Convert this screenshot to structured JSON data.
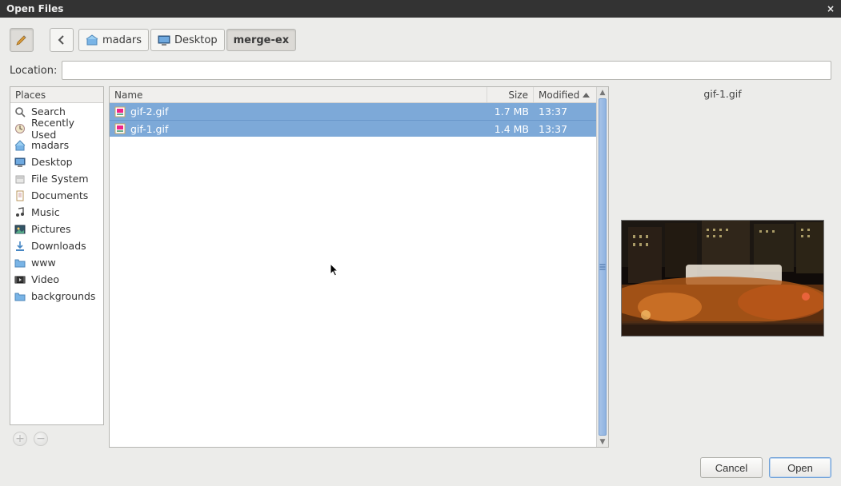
{
  "window": {
    "title": "Open Files"
  },
  "toolbar": {
    "edit_tooltip": "Type a file name",
    "back_tooltip": "Back"
  },
  "breadcrumbs": [
    {
      "label": "madars",
      "icon": "home"
    },
    {
      "label": "Desktop",
      "icon": "desktop"
    },
    {
      "label": "merge-ex",
      "icon": "",
      "current": true
    }
  ],
  "location": {
    "label": "Location:",
    "value": ""
  },
  "places": {
    "header": "Places",
    "items": [
      {
        "label": "Search",
        "icon": "search"
      },
      {
        "label": "Recently Used",
        "icon": "recent"
      },
      {
        "label": "madars",
        "icon": "home"
      },
      {
        "label": "Desktop",
        "icon": "desktop"
      },
      {
        "label": "File System",
        "icon": "disk"
      },
      {
        "label": "Documents",
        "icon": "doc"
      },
      {
        "label": "Music",
        "icon": "music"
      },
      {
        "label": "Pictures",
        "icon": "pic"
      },
      {
        "label": "Downloads",
        "icon": "download"
      },
      {
        "label": "www",
        "icon": "folder"
      },
      {
        "label": "Video",
        "icon": "video"
      },
      {
        "label": "backgrounds",
        "icon": "folder"
      }
    ]
  },
  "filelist": {
    "columns": {
      "name": "Name",
      "size": "Size",
      "modified": "Modified"
    },
    "rows": [
      {
        "name": "gif-2.gif",
        "size": "1.7 MB",
        "modified": "13:37",
        "selected": true
      },
      {
        "name": "gif-1.gif",
        "size": "1.4 MB",
        "modified": "13:37",
        "selected": true
      }
    ]
  },
  "preview": {
    "filename": "gif-1.gif"
  },
  "buttons": {
    "cancel": "Cancel",
    "open": "Open"
  }
}
